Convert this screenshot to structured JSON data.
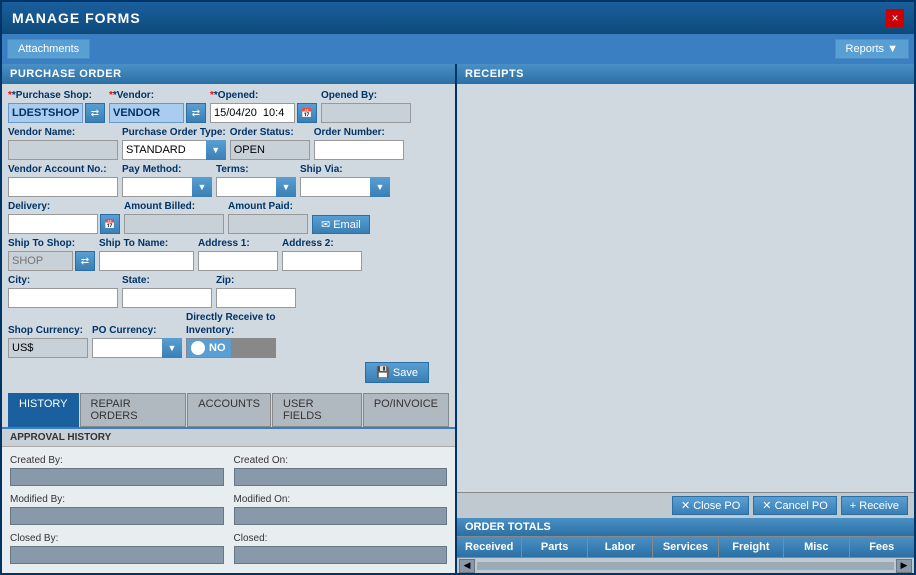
{
  "window": {
    "title": "MANAGE FORMS",
    "close_label": "×"
  },
  "toolbar": {
    "attachments_label": "Attachments",
    "reports_label": "Reports ▼"
  },
  "purchase_order": {
    "section_title": "PURCHASE ORDER",
    "fields": {
      "purchase_shop_label": "*Purchase Shop:",
      "purchase_shop_value": "LDESTSHOP",
      "vendor_label": "*Vendor:",
      "vendor_value": "VENDOR",
      "opened_label": "*Opened:",
      "opened_value": "15/04/20  10:4",
      "opened_by_label": "Opened By:",
      "opened_by_value": "",
      "vendor_name_label": "Vendor Name:",
      "vendor_name_value": "",
      "po_type_label": "Purchase Order Type:",
      "po_type_value": "STANDARD",
      "order_status_label": "Order Status:",
      "order_status_value": "OPEN",
      "order_number_label": "Order Number:",
      "order_number_value": "",
      "vendor_account_label": "Vendor Account No.:",
      "vendor_account_value": "",
      "pay_method_label": "Pay Method:",
      "pay_method_value": "",
      "terms_label": "Terms:",
      "terms_value": "",
      "ship_via_label": "Ship Via:",
      "ship_via_value": "",
      "delivery_label": "Delivery:",
      "delivery_value": "",
      "amount_billed_label": "Amount Billed:",
      "amount_billed_value": "",
      "amount_paid_label": "Amount Paid:",
      "amount_paid_value": "",
      "email_label": "Email",
      "ship_to_shop_label": "Ship To Shop:",
      "ship_to_shop_value": "SHOP",
      "ship_to_name_label": "Ship To Name:",
      "ship_to_name_value": "",
      "address1_label": "Address 1:",
      "address1_value": "",
      "address2_label": "Address 2:",
      "address2_value": "",
      "city_label": "City:",
      "city_value": "",
      "state_label": "State:",
      "state_value": "",
      "zip_label": "Zip:",
      "zip_value": "",
      "shop_currency_label": "Shop Currency:",
      "shop_currency_value": "US$",
      "po_currency_label": "PO Currency:",
      "po_currency_value": "",
      "directly_receive_label": "Directly Receive to",
      "inventory_label": "Inventory:",
      "toggle_label": "NO",
      "save_label": "Save"
    }
  },
  "tabs": {
    "items": [
      {
        "id": "history",
        "label": "HISTORY",
        "active": true
      },
      {
        "id": "repair-orders",
        "label": "REPAIR ORDERS",
        "active": false
      },
      {
        "id": "accounts",
        "label": "ACCOUNTS",
        "active": false
      },
      {
        "id": "user-fields",
        "label": "USER FIELDS",
        "active": false
      },
      {
        "id": "po-invoice",
        "label": "PO/INVOICE",
        "active": false
      }
    ]
  },
  "history": {
    "sub_header": "APPROVAL HISTORY",
    "created_by_label": "Created By:",
    "created_on_label": "Created On:",
    "modified_by_label": "Modified By:",
    "modified_on_label": "Modified On:",
    "closed_by_label": "Closed By:",
    "closed_label": "Closed:"
  },
  "receipts": {
    "section_title": "RECEIPTS"
  },
  "bottom_actions": {
    "close_po_label": "✕ Close PO",
    "cancel_po_label": "✕ Cancel PO",
    "receive_label": "+ Receive"
  },
  "order_totals": {
    "section_title": "ORDER TOTALS",
    "columns": [
      "Received",
      "Parts",
      "Labor",
      "Services",
      "Freight",
      "Misc",
      "Fees"
    ]
  }
}
